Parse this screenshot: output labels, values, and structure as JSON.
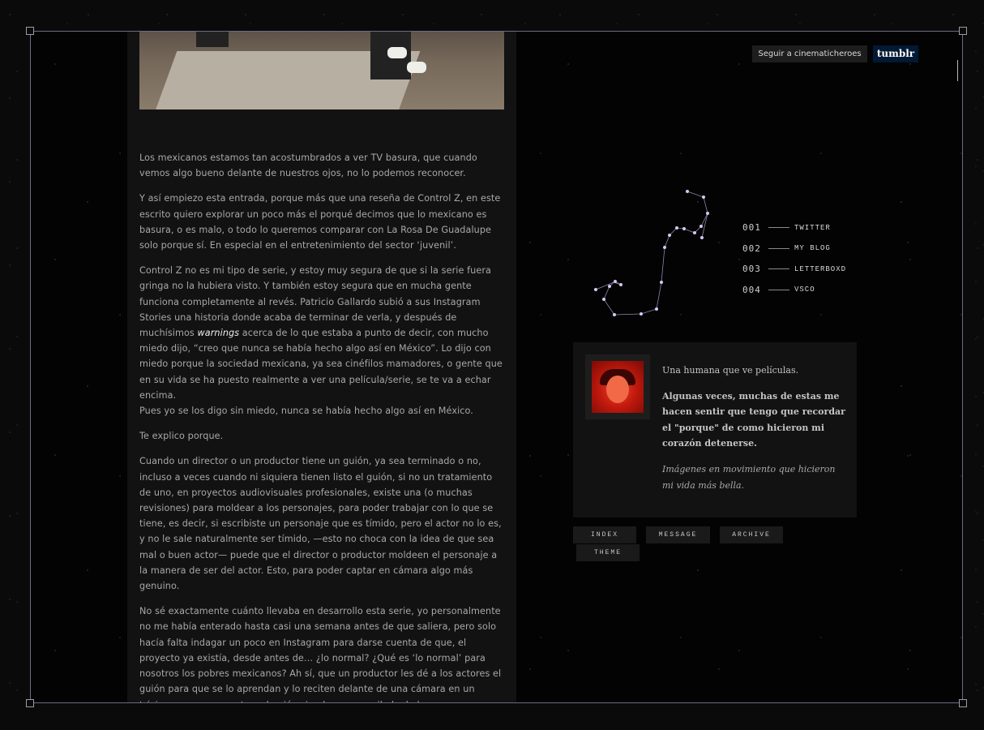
{
  "header": {
    "follow_label": "Seguir a cinematicheroes",
    "tumblr_label": "tumblr"
  },
  "post": {
    "paragraphs": [
      "Los mexicanos estamos tan acostumbrados a ver TV basura, que cuando vemos algo bueno delante de nuestros ojos, no lo podemos reconocer.",
      "Y así empiezo esta entrada, porque más que una reseña de Control Z, en este escrito quiero explorar un poco más el porqué decimos que lo mexicano es basura, o es malo, o todo lo queremos comparar con La Rosa De Guadalupe solo porque sí. En especial en el entretenimiento del sector ‘juvenil’."
    ],
    "p3_before": "Control Z no es mi tipo de serie, y estoy muy segura de que si la serie fuera gringa no la hubiera visto. Y también estoy segura que en mucha gente funciona completamente al revés. Patricio Gallardo subió a sus Instagram Stories una historia donde acaba de terminar de verla, y después de muchísimos ",
    "p3_em": "warnings",
    "p3_after": " acerca de lo que estaba a punto de decir, con mucho miedo dijo, “creo que nunca se había hecho algo así en México”. Lo dijo con miedo porque la sociedad mexicana, ya sea cinéfilos mamadores, o gente que en su vida se ha puesto realmente a ver una película/serie, se te va a echar encima.",
    "p3_last": "Pues yo se los digo sin miedo, nunca se había hecho algo así en México.",
    "p4": "Te explico porque.",
    "p5": "Cuando un director o un productor tiene un guión, ya sea terminado o no, incluso a veces cuando ni siquiera tienen listo el guión, si no un tratamiento de uno, en proyectos audiovisuales profesionales, existe una (o muchas revisiones) para moldear a los personajes, para poder trabajar con lo que se tiene, es decir, si escribiste un personaje que es tímido, pero el actor no lo es, y no le sale naturalmente ser tímido, —esto no choca con la idea de que sea mal o buen actor— puede que el director o productor moldeen el personaje a la manera de ser del actor. Esto, para poder captar en cámara algo más genuino.",
    "p6": "No sé exactamente cuánto llevaba en desarrollo esta serie, yo personalmente no me había enterado hasta casi una semana antes de que saliera, pero solo hacía falta indagar un poco en Instagram para darse cuenta de que, el proyecto ya existía, desde antes de… ¿lo normal? ¿Qué es ‘lo normal’ para nosotros los pobres mexicanos? Ah sí, que un productor les dé a los actores el guión para que se lo aprendan y lo reciten delante de una cámara en un trípie, una semana antes, el guión siendo, un recopilado de los nuevos peligros que están de moda entre los pubertos y jóvenes adultos, en la distópica Ciudad de México."
  },
  "links": [
    {
      "num": "001",
      "label": "TWITTER"
    },
    {
      "num": "002",
      "label": "MY BLOG"
    },
    {
      "num": "003",
      "label": "LETTERBOXD"
    },
    {
      "num": "004",
      "label": "VSCO"
    }
  ],
  "bio": {
    "line1": "Una humana que ve películas.",
    "line2": "Algunas veces, muchas de estas me hacen sentir que tengo que recordar el \"porque\" de como hicieron mi corazón detenerse.",
    "line3": "Imágenes en movimiento que hicieron mi vida más bella."
  },
  "nav": {
    "index": "INDEX",
    "message": "MESSAGE",
    "archive": "ARCHIVE",
    "theme": "THEME"
  },
  "colors": {
    "background": "#030304",
    "post_panel": "#121212",
    "tumblr_blue": "#001935",
    "constellation": "#c9b8e8"
  }
}
